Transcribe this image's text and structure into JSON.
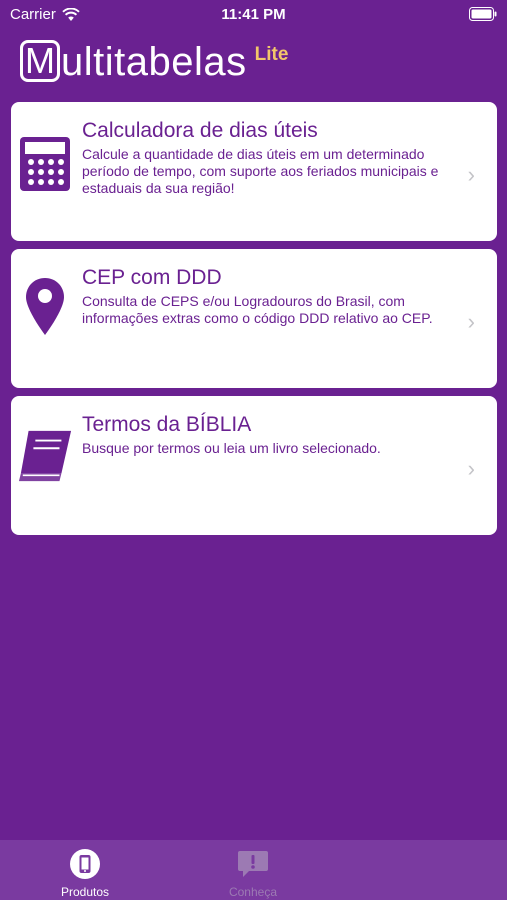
{
  "status_bar": {
    "carrier": "Carrier",
    "time": "11:41 PM"
  },
  "logo": {
    "m": "M",
    "rest": "ultitabelas",
    "lite": "Lite"
  },
  "cards": [
    {
      "title": "Calculadora de dias úteis",
      "description": "Calcule a quantidade de dias úteis em um determinado período de tempo, com suporte aos feriados municipais e estaduais da sua região!",
      "icon": "calculator-icon"
    },
    {
      "title": "CEP com DDD",
      "description": "Consulta de CEPS e/ou Logradouros do Brasil, com informações extras como o código DDD relativo ao CEP.",
      "icon": "location-pin-icon"
    },
    {
      "title": "Termos da BÍBLIA",
      "description": "Busque por termos ou leia um livro selecionado.",
      "icon": "book-icon"
    }
  ],
  "tabs": [
    {
      "label": "Produtos",
      "icon": "phone-icon",
      "active": true
    },
    {
      "label": "Conheça",
      "icon": "info-chat-icon",
      "active": false
    }
  ],
  "colors": {
    "background": "#6a2191",
    "accent": "#6a2191",
    "lite": "#f2c66a",
    "tab_bar": "#7a3aa0"
  }
}
